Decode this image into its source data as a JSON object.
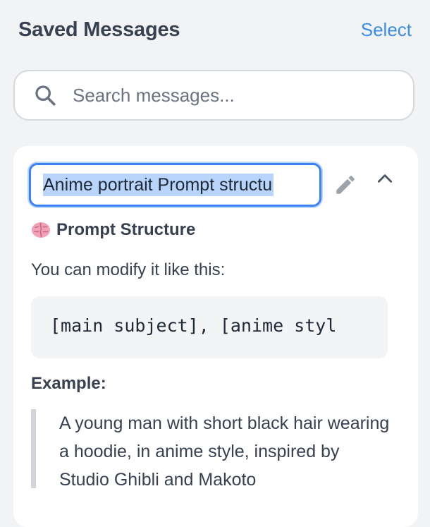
{
  "header": {
    "title": "Saved Messages",
    "select_label": "Select"
  },
  "search": {
    "icon": "search-icon",
    "placeholder": "Search messages..."
  },
  "message_card": {
    "title_input_value": "Anime portrait Prompt structu",
    "icons": [
      "pencil-icon",
      "chevron-up-icon"
    ],
    "heading_icon": "brain-icon",
    "heading": "Prompt Structure",
    "intro": "You can modify it like this:",
    "code": "[main subject], [anime styl",
    "example_label": "Example:",
    "example_text": "A young man with short black hair wearing a hoodie, in anime style, inspired by Studio Ghibli and Makoto"
  },
  "colors": {
    "accent": "#3b8ee6",
    "focus_border": "#3b82f6",
    "selection": "#b9d5fb",
    "background": "#f2f3f5"
  }
}
